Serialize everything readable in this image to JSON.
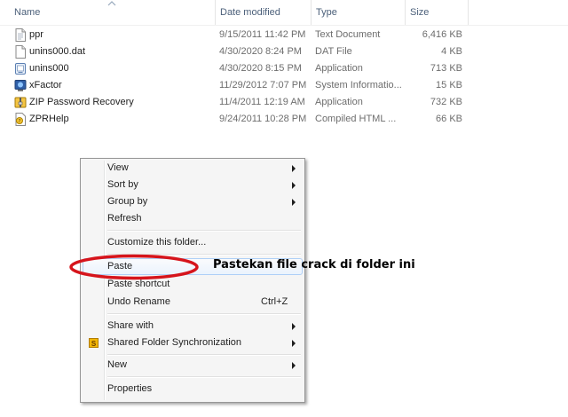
{
  "columns": {
    "name": "Name",
    "date": "Date modified",
    "type": "Type",
    "size": "Size"
  },
  "files": [
    {
      "name": "ppr",
      "date": "9/15/2011 11:42 PM",
      "type": "Text Document",
      "size": "6,416 KB",
      "icon": "text-document-icon"
    },
    {
      "name": "unins000.dat",
      "date": "4/30/2020 8:24 PM",
      "type": "DAT File",
      "size": "4 KB",
      "icon": "dat-file-icon"
    },
    {
      "name": "unins000",
      "date": "4/30/2020 8:15 PM",
      "type": "Application",
      "size": "713 KB",
      "icon": "uninstaller-icon"
    },
    {
      "name": "xFactor",
      "date": "11/29/2012 7:07 PM",
      "type": "System Informatio...",
      "size": "15 KB",
      "icon": "system-info-icon"
    },
    {
      "name": "ZIP Password Recovery",
      "date": "11/4/2011 12:19 AM",
      "type": "Application",
      "size": "732 KB",
      "icon": "zip-app-icon"
    },
    {
      "name": "ZPRHelp",
      "date": "9/24/2011 10:28 PM",
      "type": "Compiled HTML ...",
      "size": "66 KB",
      "icon": "chm-help-icon"
    }
  ],
  "context_menu": {
    "view": "View",
    "sort_by": "Sort by",
    "group_by": "Group by",
    "refresh": "Refresh",
    "customize": "Customize this folder...",
    "paste": "Paste",
    "paste_shortcut": "Paste shortcut",
    "undo_rename": "Undo Rename",
    "undo_shortcut": "Ctrl+Z",
    "share_with": "Share with",
    "shared_folder_sync": "Shared Folder Synchronization",
    "new": "New",
    "properties": "Properties"
  },
  "annotation": {
    "caption": "Pastekan file crack di folder ini",
    "highlight_color": "#d6141b"
  }
}
